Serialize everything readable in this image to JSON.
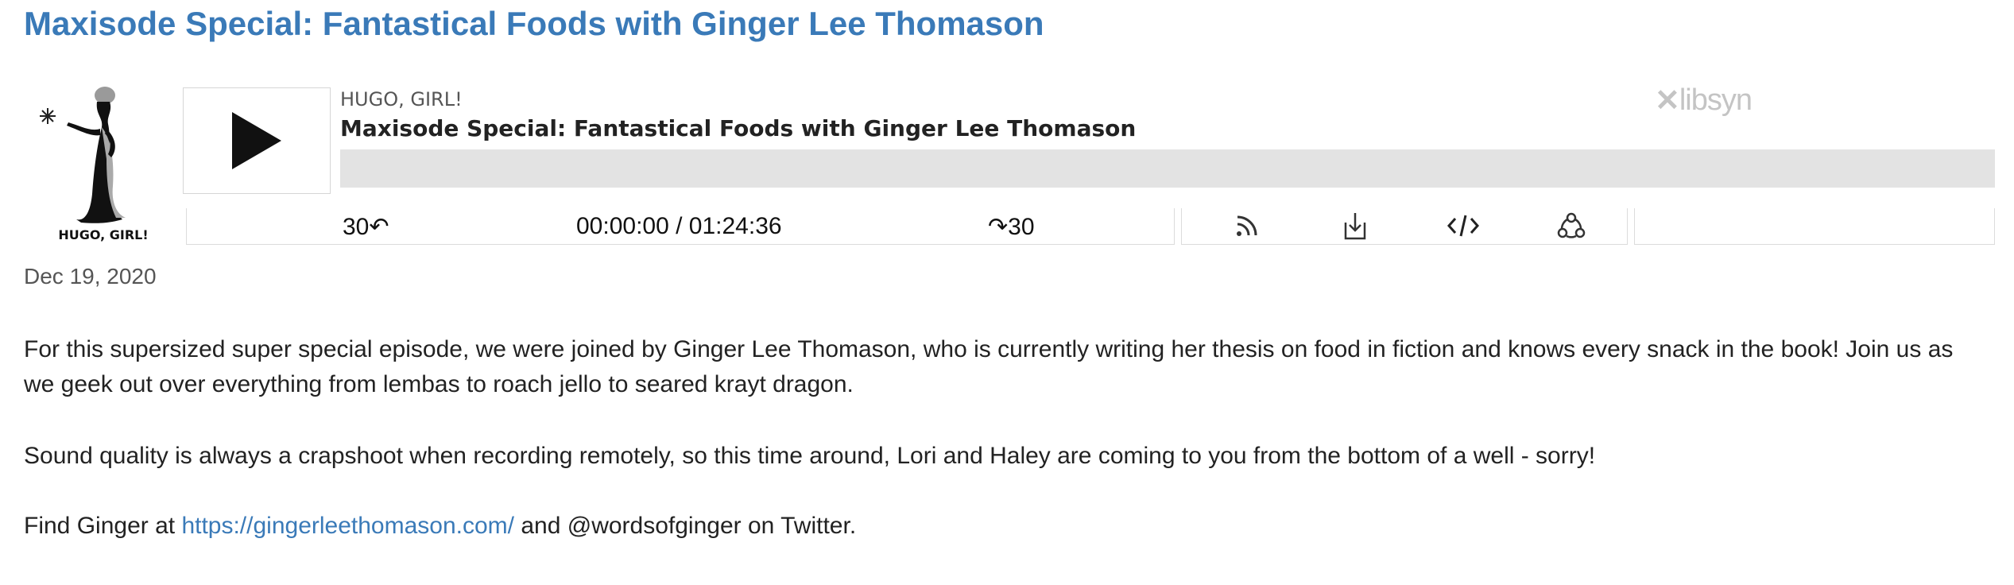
{
  "post": {
    "title": "Maxisode Special: Fantastical Foods with Ginger Lee Thomason",
    "date": "Dec 19, 2020"
  },
  "player": {
    "album_art_label": "HUGO, GIRL!",
    "show_name": "HUGO, GIRL!",
    "episode_title": "Maxisode Special: Fantastical Foods with Ginger Lee Thomason",
    "play_icon": "play-icon",
    "progress_fraction": 0,
    "skip_back_label": "30↶",
    "skip_forward_label": "↷30",
    "current_time": "00:00:00",
    "duration": "01:24:36",
    "time_separator": " / ",
    "time_display": "00:00:00 / 01:24:36",
    "icons": [
      "rss-icon",
      "download-icon",
      "embed-icon",
      "share-icon"
    ],
    "brand": "libsyn"
  },
  "description": {
    "p1": "For this supersized super special episode, we were joined by Ginger Lee Thomason, who is currently writing her thesis on food in fiction and knows every snack in the book! Join us as we geek out over everything from lembas to roach jello to seared krayt dragon.",
    "p2": "Sound quality is always a crapshoot when recording remotely, so this time around, Lori and Haley are coming to you from the bottom of a well - sorry!",
    "p3_before": "Find Ginger at ",
    "p3_link": "https://gingerleethomason.com/",
    "p3_after": " and @wordsofginger on Twitter."
  },
  "colors": {
    "link": "#3a7ab8",
    "progress_track": "#e3e3e3",
    "brand_gray": "#c4c4c4"
  }
}
